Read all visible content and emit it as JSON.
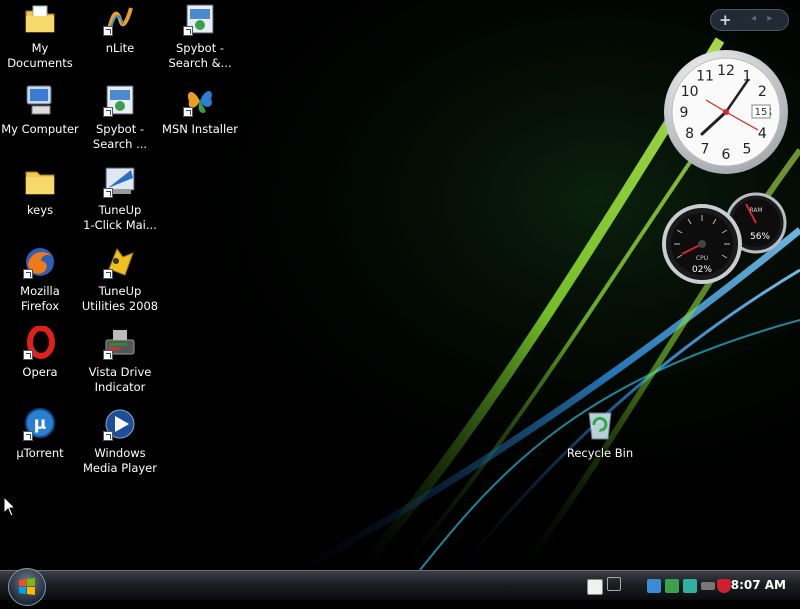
{
  "desktop_icons": [
    {
      "id": "my-documents",
      "label": "My\nDocuments",
      "icon": "documents-folder-icon"
    },
    {
      "id": "my-computer",
      "label": "My Computer",
      "icon": "computer-icon"
    },
    {
      "id": "keys",
      "label": "keys",
      "icon": "folder-icon"
    },
    {
      "id": "mozilla-firefox",
      "label": "Mozilla Firefox",
      "icon": "firefox-icon"
    },
    {
      "id": "opera",
      "label": "Opera",
      "icon": "opera-icon"
    },
    {
      "id": "utorrent",
      "label": "µTorrent",
      "icon": "utorrent-icon"
    },
    {
      "id": "nlite",
      "label": "nLite",
      "icon": "nlite-icon"
    },
    {
      "id": "spybot-2",
      "label": "Spybot -\nSearch ...",
      "icon": "spybot-icon"
    },
    {
      "id": "tuneup-1click",
      "label": "TuneUp\n1-Click Mai...",
      "icon": "tuneup-icon"
    },
    {
      "id": "tuneup-utilities",
      "label": "TuneUp\nUtilities 2008",
      "icon": "tuneup-utilities-icon"
    },
    {
      "id": "vista-drive",
      "label": "Vista Drive\nIndicator",
      "icon": "drive-icon"
    },
    {
      "id": "wmp",
      "label": "Windows\nMedia Player",
      "icon": "media-player-icon"
    },
    {
      "id": "spybot-1",
      "label": "Spybot -\nSearch &...",
      "icon": "spybot-icon"
    },
    {
      "id": "msn",
      "label": "MSN Installer",
      "icon": "msn-butterfly-icon"
    },
    {
      "id": "recycle-bin",
      "label": "Recycle Bin",
      "icon": "recycle-bin-icon"
    }
  ],
  "gadgets": {
    "clock": {
      "numbers": [
        "12",
        "1",
        "2",
        "3",
        "4",
        "5",
        "6",
        "7",
        "8",
        "9",
        "10",
        "11"
      ],
      "date": "15"
    },
    "meter": {
      "cpu_label": "CPU",
      "cpu_value": "02%",
      "mem_label": "RAM",
      "mem_value": "56%"
    },
    "control": {
      "add": "+",
      "arrows": "◂ ▸"
    }
  },
  "taskbar": {
    "start_icon": "windows-orb-icon",
    "time": "8:07 AM",
    "tray_icons": [
      "help-icon",
      "network-icon",
      "devices-icon",
      "sync-icon",
      "update-icon",
      "drive-icon",
      "security-shield-icon"
    ]
  },
  "colors": {
    "taskbar": "#1c1f22",
    "wallpaper_green": "#7fd12a",
    "wallpaper_blue": "#2a8ad8"
  }
}
